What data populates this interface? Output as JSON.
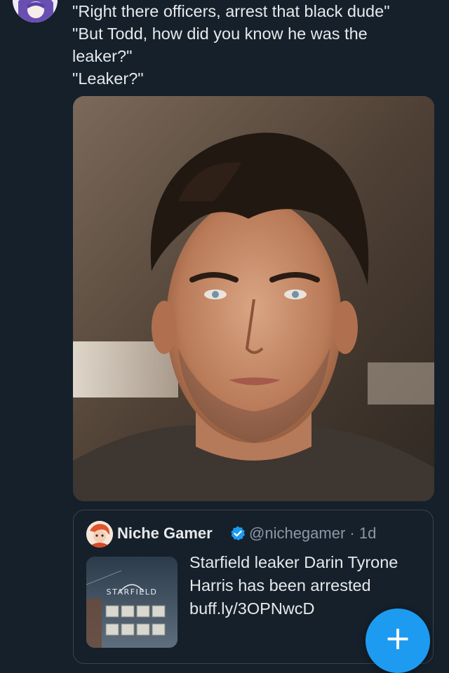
{
  "tweet": {
    "lines": [
      "\"Right there officers, arrest that black dude\"",
      "\"But Todd, how did you know he was the",
      "leaker?\"",
      "\"Leaker?\""
    ],
    "media_icon": "photo-portrait"
  },
  "quote": {
    "name": "Niche Gamer",
    "handle_time": "@nichegamer · 1d",
    "verified": true,
    "text_lines": [
      "Starfield leaker Darin Tyrone",
      "Harris has been arrested",
      "buff.ly/3OPNwcD"
    ],
    "thumb_title": "STARFIELD"
  },
  "fab": {
    "label": "+"
  },
  "colors": {
    "background": "#15202b",
    "text": "#e7e9ea",
    "secondary_text": "#8b98a5",
    "accent": "#1d9bf0",
    "border": "#38444d"
  }
}
